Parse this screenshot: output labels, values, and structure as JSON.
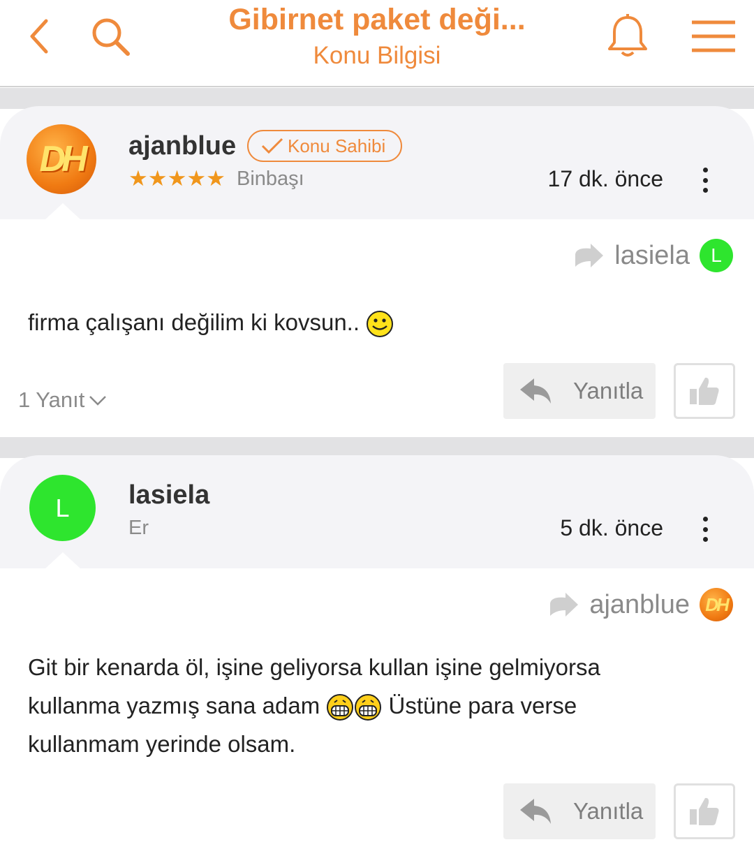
{
  "header": {
    "title": "Gibirnet paket deği...",
    "subtitle": "Konu Bilgisi",
    "accent_color": "#ef8a3c",
    "icons": [
      "chevron-left-icon",
      "search-icon",
      "bell-icon",
      "menu-icon"
    ]
  },
  "posts": [
    {
      "author": "ajanblue",
      "avatar_text": "DH",
      "badge": "Konu Sahibi",
      "stars": 5,
      "rank": "Binbaşı",
      "time": "17 dk. önce",
      "reply_to": {
        "name": "lasiela",
        "avatar_text": "L"
      },
      "content": "firma çalışanı değilim ki kovsun..",
      "replies_count": "1 Yanıt",
      "reply_button": "Yanıtla"
    },
    {
      "author": "lasiela",
      "avatar_text": "L",
      "rank": "Er",
      "time": "5 dk. önce",
      "reply_to": {
        "name": "ajanblue",
        "avatar_text": "DH"
      },
      "content_line1": "Git bir kenarda öl, işine geliyorsa kullan işine gelmiyorsa",
      "content_line2a": "kullanma yazmış sana adam",
      "content_line2b": "Üstüne para verse",
      "content_line3": "kullanmam yerinde olsam.",
      "reply_button": "Yanıtla"
    }
  ]
}
